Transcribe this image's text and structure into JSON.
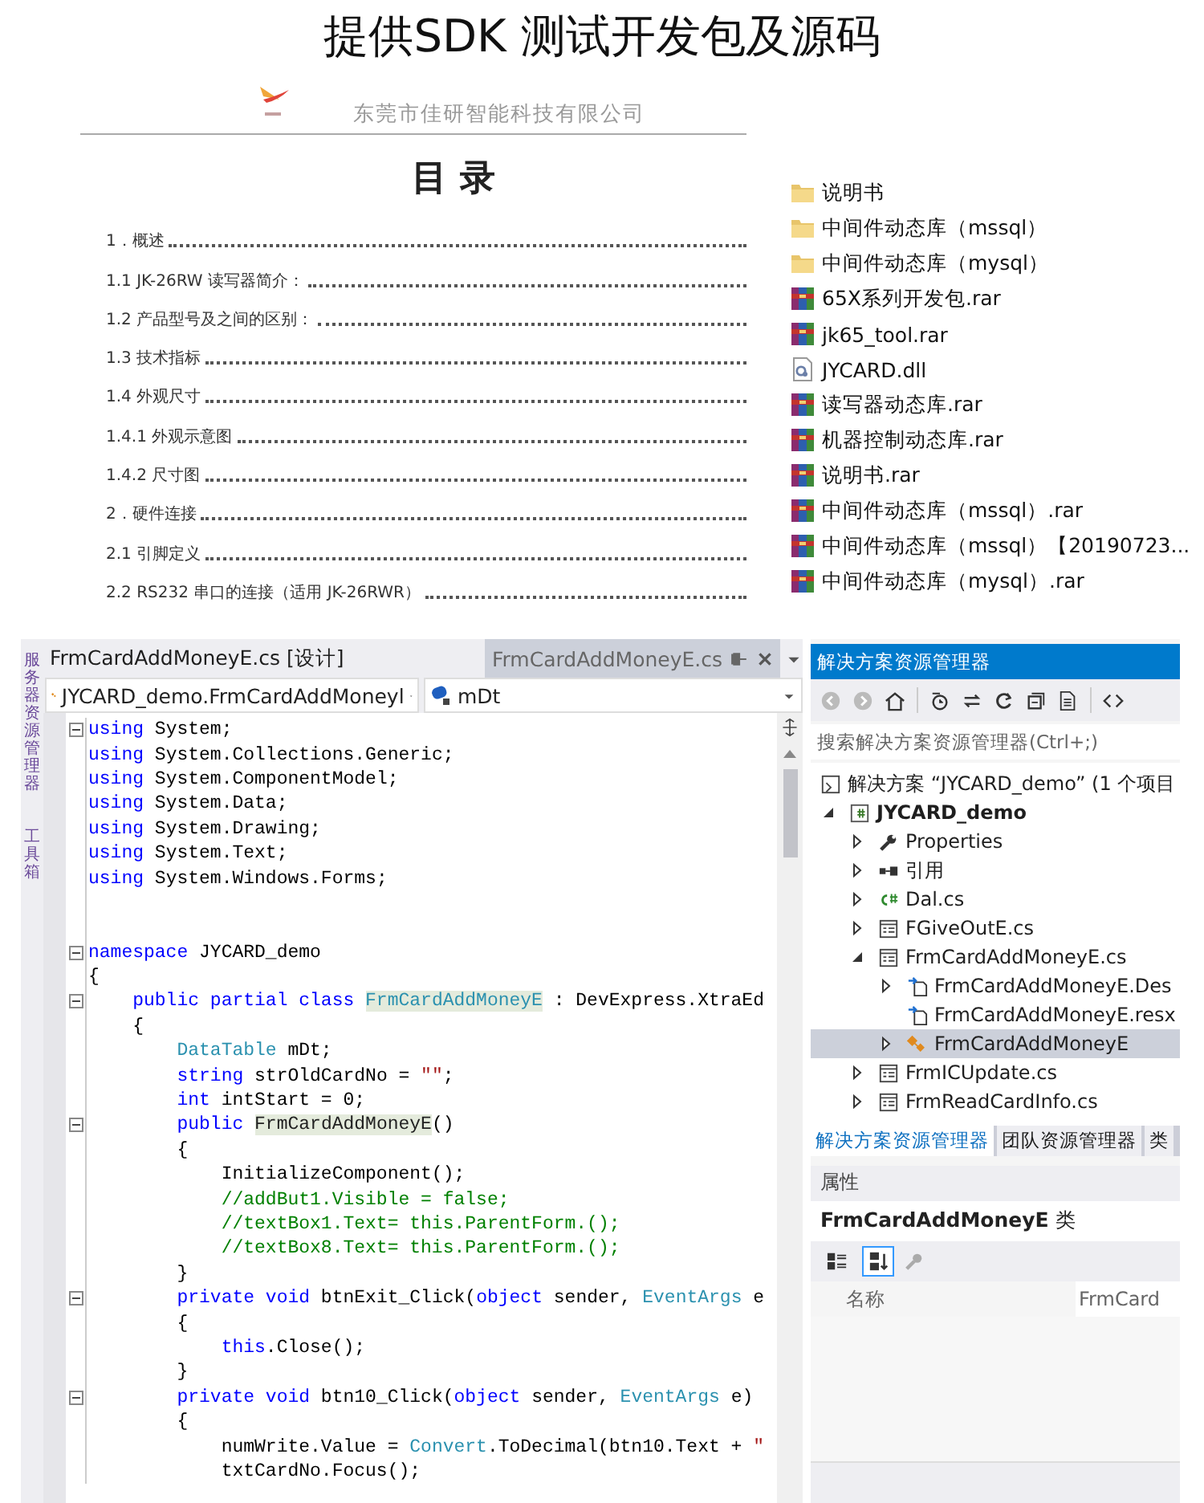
{
  "heading": "提供SDK 测试开发包及源码",
  "document": {
    "company": "东莞市佳研智能科技有限公司",
    "title": "目 录",
    "toc": [
      "1．概述",
      "1.1  JK-26RW 读写器简介：",
      "1.2 产品型号及之间的区别：",
      "1.3 技术指标",
      "1.4 外观尺寸",
      "1.4.1  外观示意图",
      "1.4.2 尺寸图",
      "2．硬件连接",
      "2.1 引脚定义",
      "2.2   RS232 串口的连接（适用 JK-26RWR）"
    ]
  },
  "files": [
    {
      "kind": "folder",
      "name": "说明书"
    },
    {
      "kind": "folder",
      "name": "中间件动态库（mssql）"
    },
    {
      "kind": "folder",
      "name": "中间件动态库（mysql）"
    },
    {
      "kind": "archive",
      "name": "65X系列开发包.rar"
    },
    {
      "kind": "archive",
      "name": "jk65_tool.rar"
    },
    {
      "kind": "library",
      "name": "JYCARD.dll"
    },
    {
      "kind": "archive",
      "name": "读写器动态库.rar"
    },
    {
      "kind": "archive",
      "name": "机器控制动态库.rar"
    },
    {
      "kind": "archive",
      "name": "说明书.rar"
    },
    {
      "kind": "archive",
      "name": "中间件动态库（mssql）.rar"
    },
    {
      "kind": "archive",
      "name": "中间件动态库（mssql）【20190723..."
    },
    {
      "kind": "archive",
      "name": "中间件动态库（mysql）.rar"
    }
  ],
  "ide": {
    "side_tabs": [
      "服务器资源管理器",
      "工具箱"
    ],
    "editor": {
      "tabs": [
        {
          "label": "FrmCardAddMoneyE.cs [设计]",
          "selected": false
        },
        {
          "label": "FrmCardAddMoneyE.cs",
          "selected": true
        }
      ],
      "type_dropdown": "JYCARD_demo.FrmCardAddMoneyl",
      "member_dropdown": "mDt",
      "lines": [
        {
          "fold": true,
          "tokens": [
            {
              "kind": "kw",
              "text": "using"
            },
            {
              "kind": "plain",
              "text": " System;"
            }
          ]
        },
        {
          "fold": false,
          "tokens": [
            {
              "kind": "kw",
              "text": "using"
            },
            {
              "kind": "plain",
              "text": " System.Collections.Generic;"
            }
          ]
        },
        {
          "fold": false,
          "tokens": [
            {
              "kind": "kw",
              "text": "using"
            },
            {
              "kind": "plain",
              "text": " System.ComponentModel;"
            }
          ]
        },
        {
          "fold": false,
          "tokens": [
            {
              "kind": "kw",
              "text": "using"
            },
            {
              "kind": "plain",
              "text": " System.Data;"
            }
          ]
        },
        {
          "fold": false,
          "tokens": [
            {
              "kind": "kw",
              "text": "using"
            },
            {
              "kind": "plain",
              "text": " System.Drawing;"
            }
          ]
        },
        {
          "fold": false,
          "tokens": [
            {
              "kind": "kw",
              "text": "using"
            },
            {
              "kind": "plain",
              "text": " System.Text;"
            }
          ]
        },
        {
          "fold": false,
          "tokens": [
            {
              "kind": "kw",
              "text": "using"
            },
            {
              "kind": "plain",
              "text": " System.Windows.Forms;"
            }
          ]
        },
        {
          "fold": false
        },
        {
          "fold": false
        },
        {
          "fold": true,
          "tokens": [
            {
              "kind": "kw",
              "text": "namespace"
            },
            {
              "kind": "plain",
              "text": " JYCARD_demo"
            }
          ]
        },
        {
          "fold": false,
          "tokens": [
            {
              "kind": "plain",
              "text": "{"
            }
          ]
        },
        {
          "fold": true,
          "tokens": [
            {
              "kind": "kw",
              "text": "    public partial class "
            },
            {
              "kind": "type_highlight",
              "text": "FrmCardAddMoneyE"
            },
            {
              "kind": "plain",
              "text": " : DevExpress.XtraEd"
            }
          ]
        },
        {
          "fold": false,
          "tokens": [
            {
              "kind": "plain",
              "text": "    {"
            }
          ]
        },
        {
          "fold": false,
          "tokens": [
            {
              "kind": "type",
              "text": "        DataTable"
            },
            {
              "kind": "plain",
              "text": " mDt;"
            }
          ]
        },
        {
          "fold": false,
          "tokens": [
            {
              "kind": "kw",
              "text": "        string"
            },
            {
              "kind": "plain",
              "text": " strOldCardNo = "
            },
            {
              "kind": "str",
              "text": "\"\""
            },
            {
              "kind": "plain",
              "text": ";"
            }
          ]
        },
        {
          "fold": false,
          "tokens": [
            {
              "kind": "kw",
              "text": "        int"
            },
            {
              "kind": "plain",
              "text": " intStart = 0;"
            }
          ]
        },
        {
          "fold": true,
          "tokens": [
            {
              "kind": "kw",
              "text": "        public "
            },
            {
              "kind": "highlight",
              "text": "FrmCardAddMoneyE"
            },
            {
              "kind": "plain",
              "text": "()"
            }
          ]
        },
        {
          "fold": false,
          "tokens": [
            {
              "kind": "plain",
              "text": "        {"
            }
          ]
        },
        {
          "fold": false,
          "tokens": [
            {
              "kind": "plain",
              "text": "            InitializeComponent();"
            }
          ]
        },
        {
          "fold": false,
          "tokens": [
            {
              "kind": "comment",
              "text": "            //addBut1.Visible = false;"
            }
          ]
        },
        {
          "fold": false,
          "tokens": [
            {
              "kind": "comment",
              "text": "            //textBox1.Text= this.ParentForm.();"
            }
          ]
        },
        {
          "fold": false,
          "tokens": [
            {
              "kind": "comment",
              "text": "            //textBox8.Text= this.ParentForm.();"
            }
          ]
        },
        {
          "fold": false,
          "tokens": [
            {
              "kind": "plain",
              "text": "        }"
            }
          ]
        },
        {
          "fold": true,
          "tokens": [
            {
              "kind": "kw",
              "text": "        private void"
            },
            {
              "kind": "plain",
              "text": " btnExit_Click("
            },
            {
              "kind": "kw",
              "text": "object"
            },
            {
              "kind": "plain",
              "text": " sender, "
            },
            {
              "kind": "type",
              "text": "EventArgs"
            },
            {
              "kind": "plain",
              "text": " e"
            }
          ]
        },
        {
          "fold": false,
          "tokens": [
            {
              "kind": "plain",
              "text": "        {"
            }
          ]
        },
        {
          "fold": false,
          "tokens": [
            {
              "kind": "kw",
              "text": "            this"
            },
            {
              "kind": "plain",
              "text": ".Close();"
            }
          ]
        },
        {
          "fold": false,
          "tokens": [
            {
              "kind": "plain",
              "text": "        }"
            }
          ]
        },
        {
          "fold": true,
          "tokens": [
            {
              "kind": "kw",
              "text": "        private void"
            },
            {
              "kind": "plain",
              "text": " btn10_Click("
            },
            {
              "kind": "kw",
              "text": "object"
            },
            {
              "kind": "plain",
              "text": " sender, "
            },
            {
              "kind": "type",
              "text": "EventArgs"
            },
            {
              "kind": "plain",
              "text": " e)"
            }
          ]
        },
        {
          "fold": false,
          "tokens": [
            {
              "kind": "plain",
              "text": "        {"
            }
          ]
        },
        {
          "fold": false,
          "tokens": [
            {
              "kind": "plain",
              "text": "            numWrite.Value = "
            },
            {
              "kind": "type",
              "text": "Convert"
            },
            {
              "kind": "plain",
              "text": ".ToDecimal(btn10.Text + "
            },
            {
              "kind": "str",
              "text": "\""
            }
          ]
        },
        {
          "fold": false,
          "tokens": [
            {
              "kind": "plain",
              "text": "            txtCardNo.Focus();"
            }
          ]
        }
      ]
    },
    "explorer": {
      "title": "解决方案资源管理器",
      "search": {
        "placeholder": "搜索解决方案资源管理器(Ctrl+;)"
      },
      "tree": [
        {
          "kind": "solution",
          "label": "解决方案 “JYCARD_demo” (1 个项目",
          "expandable": false,
          "selected": false
        },
        {
          "kind": "project",
          "label": "JYCARD_demo",
          "expandable": true,
          "expanded": true,
          "selected": false,
          "children": [
            {
              "kind": "properties",
              "label": "Properties",
              "expandable": true,
              "expanded": false,
              "selected": false
            },
            {
              "kind": "references",
              "label": "引用",
              "expandable": true,
              "expanded": false,
              "selected": false
            },
            {
              "kind": "code",
              "label": "Dal.cs",
              "expandable": true,
              "expanded": false,
              "selected": false
            },
            {
              "kind": "form",
              "label": "FGiveOutE.cs",
              "expandable": true,
              "expanded": false,
              "selected": false
            },
            {
              "kind": "form",
              "label": "FrmCardAddMoneyE.cs",
              "expandable": true,
              "expanded": true,
              "selected": false,
              "children": [
                {
                  "kind": "designer",
                  "label": "FrmCardAddMoneyE.Des",
                  "expandable": true,
                  "expanded": false,
                  "selected": false
                },
                {
                  "kind": "designer",
                  "label": "FrmCardAddMoneyE.resx",
                  "expandable": false,
                  "selected": false
                },
                {
                  "kind": "class",
                  "label": "FrmCardAddMoneyE",
                  "expandable": true,
                  "expanded": false,
                  "selected": true
                }
              ]
            },
            {
              "kind": "form",
              "label": "FrmICUpdate.cs",
              "expandable": true,
              "expanded": false,
              "selected": false
            },
            {
              "kind": "form",
              "label": "FrmReadCardInfo.cs",
              "expandable": true,
              "expanded": false,
              "selected": false
            }
          ]
        }
      ],
      "bottom_tabs": [
        {
          "label": "解决方案资源管理器",
          "selected": true
        },
        {
          "label": "团队资源管理器",
          "selected": false
        },
        {
          "label": "类",
          "selected": false
        }
      ]
    },
    "properties": {
      "title": "属性",
      "object": "FrmCardAddMoneyE",
      "object_type": "类",
      "sort_buttons": [
        {
          "selected": false
        },
        {
          "selected": true
        }
      ],
      "rows": [
        {
          "name": "名称",
          "value": "FrmCard"
        }
      ]
    }
  }
}
